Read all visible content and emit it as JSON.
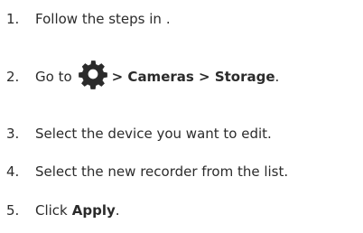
{
  "steps": [
    {
      "number": "1.",
      "text_before": "Follow the steps in",
      "text_after": "."
    },
    {
      "number": "2.",
      "text_before": "Go to",
      "icon": "gear-icon",
      "path": "> Cameras > Storage",
      "text_after": "."
    },
    {
      "number": "3.",
      "text": "Select the device you want to edit."
    },
    {
      "number": "4.",
      "text": "Select the new recorder from the list."
    },
    {
      "number": "5.",
      "text_before": "Click",
      "bold": "Apply",
      "text_after": "."
    }
  ],
  "colors": {
    "text": "#2b2b2b",
    "icon": "#2b2b2b"
  }
}
